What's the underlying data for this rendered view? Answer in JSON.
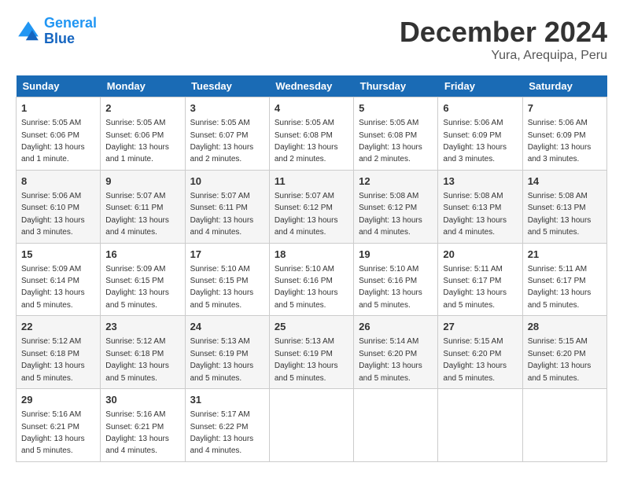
{
  "logo": {
    "line1": "General",
    "line2": "Blue"
  },
  "title": "December 2024",
  "location": "Yura, Arequipa, Peru",
  "days_of_week": [
    "Sunday",
    "Monday",
    "Tuesday",
    "Wednesday",
    "Thursday",
    "Friday",
    "Saturday"
  ],
  "weeks": [
    [
      {
        "day": 1,
        "sunrise": "5:05 AM",
        "sunset": "6:06 PM",
        "daylight": "13 hours and 1 minute."
      },
      {
        "day": 2,
        "sunrise": "5:05 AM",
        "sunset": "6:06 PM",
        "daylight": "13 hours and 1 minute."
      },
      {
        "day": 3,
        "sunrise": "5:05 AM",
        "sunset": "6:07 PM",
        "daylight": "13 hours and 2 minutes."
      },
      {
        "day": 4,
        "sunrise": "5:05 AM",
        "sunset": "6:08 PM",
        "daylight": "13 hours and 2 minutes."
      },
      {
        "day": 5,
        "sunrise": "5:05 AM",
        "sunset": "6:08 PM",
        "daylight": "13 hours and 2 minutes."
      },
      {
        "day": 6,
        "sunrise": "5:06 AM",
        "sunset": "6:09 PM",
        "daylight": "13 hours and 3 minutes."
      },
      {
        "day": 7,
        "sunrise": "5:06 AM",
        "sunset": "6:09 PM",
        "daylight": "13 hours and 3 minutes."
      }
    ],
    [
      {
        "day": 8,
        "sunrise": "5:06 AM",
        "sunset": "6:10 PM",
        "daylight": "13 hours and 3 minutes."
      },
      {
        "day": 9,
        "sunrise": "5:07 AM",
        "sunset": "6:11 PM",
        "daylight": "13 hours and 4 minutes."
      },
      {
        "day": 10,
        "sunrise": "5:07 AM",
        "sunset": "6:11 PM",
        "daylight": "13 hours and 4 minutes."
      },
      {
        "day": 11,
        "sunrise": "5:07 AM",
        "sunset": "6:12 PM",
        "daylight": "13 hours and 4 minutes."
      },
      {
        "day": 12,
        "sunrise": "5:08 AM",
        "sunset": "6:12 PM",
        "daylight": "13 hours and 4 minutes."
      },
      {
        "day": 13,
        "sunrise": "5:08 AM",
        "sunset": "6:13 PM",
        "daylight": "13 hours and 4 minutes."
      },
      {
        "day": 14,
        "sunrise": "5:08 AM",
        "sunset": "6:13 PM",
        "daylight": "13 hours and 5 minutes."
      }
    ],
    [
      {
        "day": 15,
        "sunrise": "5:09 AM",
        "sunset": "6:14 PM",
        "daylight": "13 hours and 5 minutes."
      },
      {
        "day": 16,
        "sunrise": "5:09 AM",
        "sunset": "6:15 PM",
        "daylight": "13 hours and 5 minutes."
      },
      {
        "day": 17,
        "sunrise": "5:10 AM",
        "sunset": "6:15 PM",
        "daylight": "13 hours and 5 minutes."
      },
      {
        "day": 18,
        "sunrise": "5:10 AM",
        "sunset": "6:16 PM",
        "daylight": "13 hours and 5 minutes."
      },
      {
        "day": 19,
        "sunrise": "5:10 AM",
        "sunset": "6:16 PM",
        "daylight": "13 hours and 5 minutes."
      },
      {
        "day": 20,
        "sunrise": "5:11 AM",
        "sunset": "6:17 PM",
        "daylight": "13 hours and 5 minutes."
      },
      {
        "day": 21,
        "sunrise": "5:11 AM",
        "sunset": "6:17 PM",
        "daylight": "13 hours and 5 minutes."
      }
    ],
    [
      {
        "day": 22,
        "sunrise": "5:12 AM",
        "sunset": "6:18 PM",
        "daylight": "13 hours and 5 minutes."
      },
      {
        "day": 23,
        "sunrise": "5:12 AM",
        "sunset": "6:18 PM",
        "daylight": "13 hours and 5 minutes."
      },
      {
        "day": 24,
        "sunrise": "5:13 AM",
        "sunset": "6:19 PM",
        "daylight": "13 hours and 5 minutes."
      },
      {
        "day": 25,
        "sunrise": "5:13 AM",
        "sunset": "6:19 PM",
        "daylight": "13 hours and 5 minutes."
      },
      {
        "day": 26,
        "sunrise": "5:14 AM",
        "sunset": "6:20 PM",
        "daylight": "13 hours and 5 minutes."
      },
      {
        "day": 27,
        "sunrise": "5:15 AM",
        "sunset": "6:20 PM",
        "daylight": "13 hours and 5 minutes."
      },
      {
        "day": 28,
        "sunrise": "5:15 AM",
        "sunset": "6:20 PM",
        "daylight": "13 hours and 5 minutes."
      }
    ],
    [
      {
        "day": 29,
        "sunrise": "5:16 AM",
        "sunset": "6:21 PM",
        "daylight": "13 hours and 5 minutes."
      },
      {
        "day": 30,
        "sunrise": "5:16 AM",
        "sunset": "6:21 PM",
        "daylight": "13 hours and 4 minutes."
      },
      {
        "day": 31,
        "sunrise": "5:17 AM",
        "sunset": "6:22 PM",
        "daylight": "13 hours and 4 minutes."
      },
      null,
      null,
      null,
      null
    ]
  ]
}
